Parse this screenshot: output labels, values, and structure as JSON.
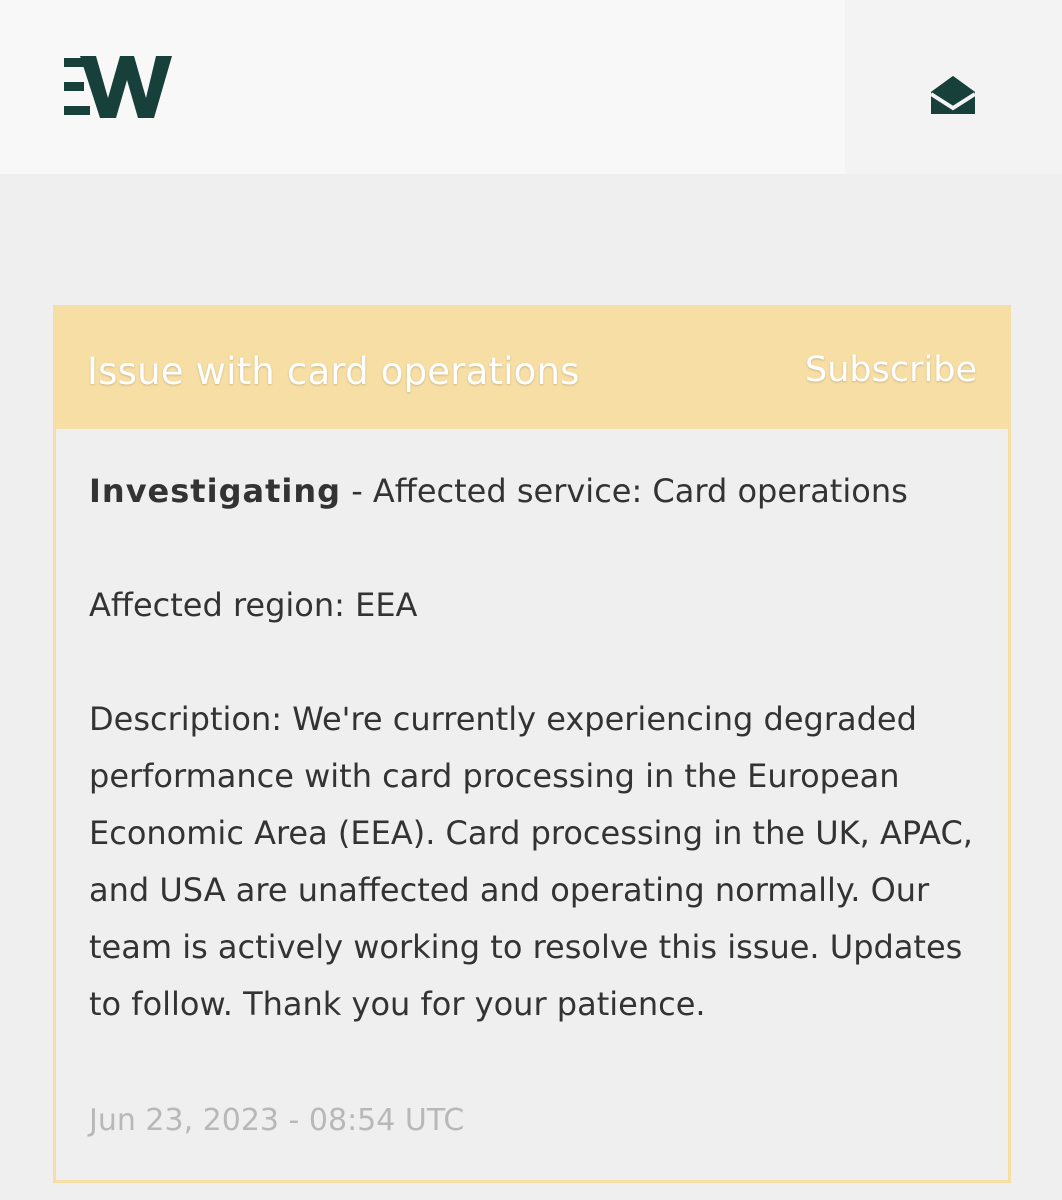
{
  "header": {
    "logo_alt": "Wirex logo",
    "mail_icon": "envelope-open-icon"
  },
  "incident": {
    "title": "Issue with card operations",
    "subscribe_label": "Subscribe",
    "status": "Investigating",
    "separator": " - ",
    "affected_service": "Affected service: Card operations",
    "affected_region": "Affected region: EEA",
    "description": "Description: We're currently experiencing degraded performance with card processing in the European Economic Area (EEA). Card processing in the UK, APAC, and USA are unaffected and operating normally. Our team is actively working to resolve this issue. Updates to follow. Thank you for your patience.",
    "timestamp": "Jun 23, 2023 - 08:54 UTC"
  },
  "colors": {
    "brand": "#17403a",
    "incident_accent": "#f7dea4",
    "background": "#efefef",
    "header_background": "#f8f8f8",
    "text": "#333333",
    "timestamp": "#b8b8b8"
  }
}
